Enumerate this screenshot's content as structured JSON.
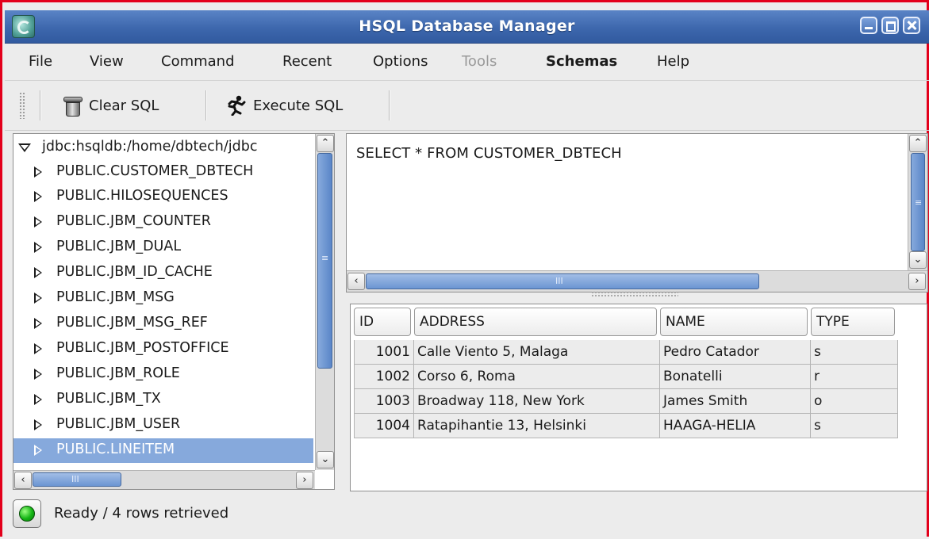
{
  "window": {
    "title": "HSQL Database Manager"
  },
  "menu": [
    {
      "label": "File",
      "state": "enabled"
    },
    {
      "label": "View",
      "state": "enabled"
    },
    {
      "label": "Command",
      "state": "enabled"
    },
    {
      "label": "Recent",
      "state": "enabled"
    },
    {
      "label": "Options",
      "state": "enabled"
    },
    {
      "label": "Tools",
      "state": "disabled"
    },
    {
      "label": "Schemas",
      "state": "bold"
    },
    {
      "label": "Help",
      "state": "enabled"
    }
  ],
  "toolbar": {
    "clear_sql": {
      "label": "Clear SQL",
      "icon": "trash-can-icon"
    },
    "execute_sql": {
      "label": "Execute SQL",
      "icon": "running-man-icon"
    }
  },
  "tree": {
    "root": "jdbc:hsqldb:/home/dbtech/jdbc",
    "items": [
      "PUBLIC.CUSTOMER_DBTECH",
      "PUBLIC.HILOSEQUENCES",
      "PUBLIC.JBM_COUNTER",
      "PUBLIC.JBM_DUAL",
      "PUBLIC.JBM_ID_CACHE",
      "PUBLIC.JBM_MSG",
      "PUBLIC.JBM_MSG_REF",
      "PUBLIC.JBM_POSTOFFICE",
      "PUBLIC.JBM_ROLE",
      "PUBLIC.JBM_TX",
      "PUBLIC.JBM_USER",
      "PUBLIC.LINEITEM"
    ],
    "selected": "PUBLIC.LINEITEM"
  },
  "sql": {
    "text": "SELECT * FROM CUSTOMER_DBTECH"
  },
  "results": {
    "columns": [
      "ID",
      "ADDRESS",
      "NAME",
      "TYPE"
    ],
    "rows": [
      [
        "1001",
        "Calle Viento 5, Malaga",
        "Pedro Catador",
        "s"
      ],
      [
        "1002",
        "Corso 6, Roma",
        "Bonatelli",
        "r"
      ],
      [
        "1003",
        "Broadway 118, New York",
        "James Smith",
        "o"
      ],
      [
        "1004",
        "Ratapihantie 13, Helsinki",
        "HAAGA-HELIA",
        "s"
      ]
    ]
  },
  "status": {
    "text": "Ready / 4 rows retrieved",
    "indicator_color": "#14b515"
  }
}
